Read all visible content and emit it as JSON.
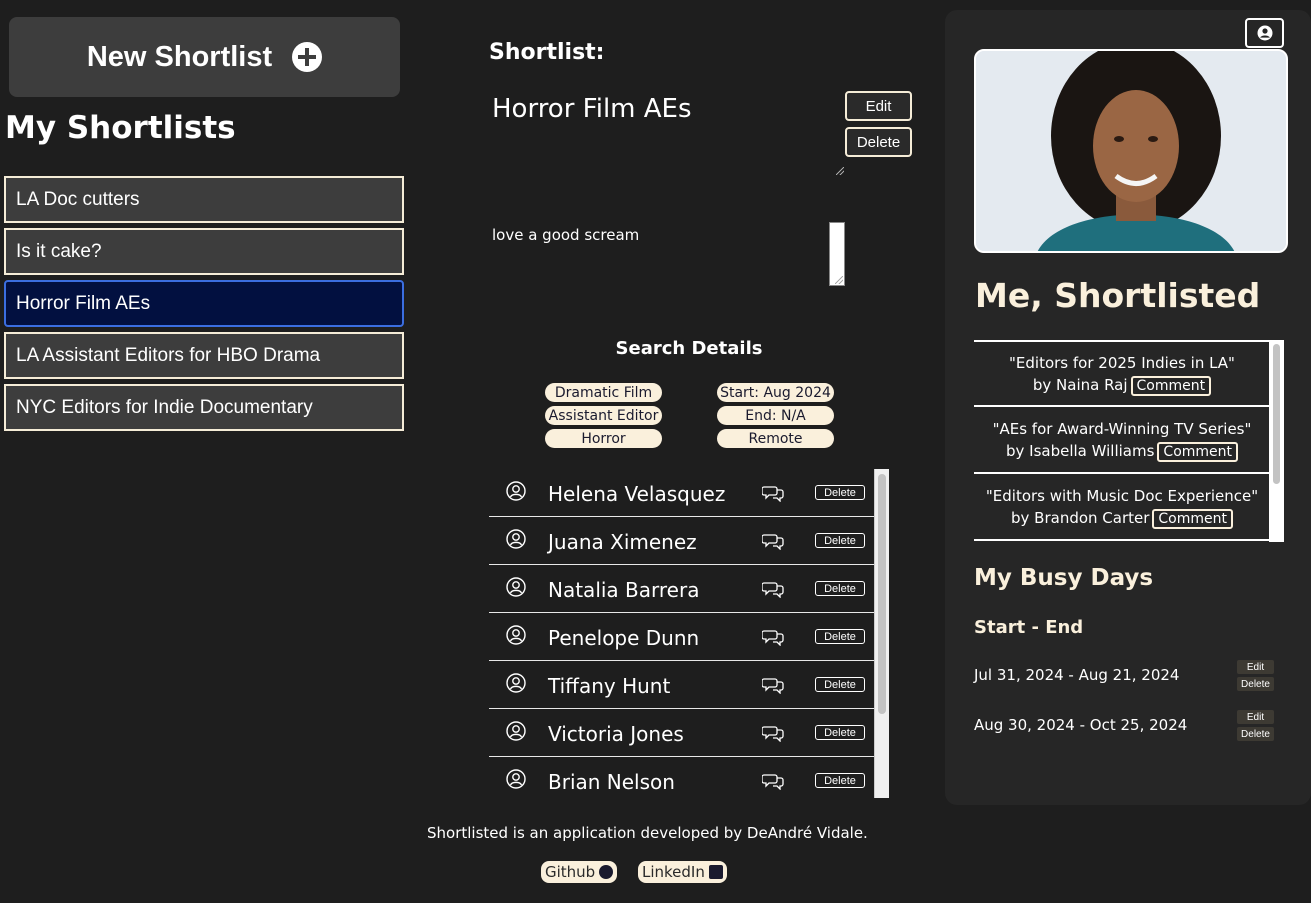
{
  "sidebar": {
    "new_shortlist_label": "New Shortlist",
    "heading": "My Shortlists",
    "items": [
      {
        "label": "LA Doc cutters"
      },
      {
        "label": "Is it cake?"
      },
      {
        "label": "Horror Film AEs"
      },
      {
        "label": "LA Assistant Editors for HBO Drama"
      },
      {
        "label": "NYC Editors for Indie Documentary"
      }
    ],
    "active_index": 2
  },
  "main": {
    "shortlist_label": "Shortlist:",
    "title": "Horror Film AEs",
    "edit_label": "Edit",
    "delete_label": "Delete",
    "description": "love a good scream",
    "search_details_heading": "Search Details",
    "tags_left": [
      "Dramatic Film",
      "Assistant Editor",
      "Horror"
    ],
    "tags_right": [
      "Start: Aug 2024",
      "End: N/A",
      "Remote"
    ],
    "people": [
      {
        "name": "Helena Velasquez",
        "delete": "Delete"
      },
      {
        "name": "Juana Ximenez",
        "delete": "Delete"
      },
      {
        "name": "Natalia Barrera",
        "delete": "Delete"
      },
      {
        "name": "Penelope Dunn",
        "delete": "Delete"
      },
      {
        "name": "Tiffany Hunt",
        "delete": "Delete"
      },
      {
        "name": "Victoria Jones",
        "delete": "Delete"
      },
      {
        "name": "Brian Nelson",
        "delete": "Delete"
      }
    ]
  },
  "footer": {
    "text": "Shortlisted is an application developed by DeAndré Vidale.",
    "github": "Github",
    "linkedin": "LinkedIn"
  },
  "profile": {
    "me_heading": "Me, Shortlisted",
    "featured": [
      {
        "title": "\"Editors for 2025 Indies in LA\"",
        "by": "by Naina Raj",
        "comment": "Comment"
      },
      {
        "title": "\"AEs for Award-Winning TV Series\"",
        "by": "by Isabella Williams",
        "comment": "Comment"
      },
      {
        "title": "\"Editors with Music Doc Experience\"",
        "by": "by Brandon Carter",
        "comment": "Comment"
      }
    ],
    "busy_heading": "My Busy Days",
    "start_end_label": "Start - End",
    "busy_days": [
      {
        "range": "Jul 31, 2024 - Aug 21, 2024",
        "edit": "Edit",
        "delete": "Delete"
      },
      {
        "range": "Aug 30, 2024 - Oct 25, 2024",
        "edit": "Edit",
        "delete": "Delete"
      }
    ]
  },
  "colors": {
    "background": "#1e1e1e",
    "accent_cream": "#faf0dc",
    "active_item": "#021040",
    "active_border": "#3b6ee0"
  }
}
